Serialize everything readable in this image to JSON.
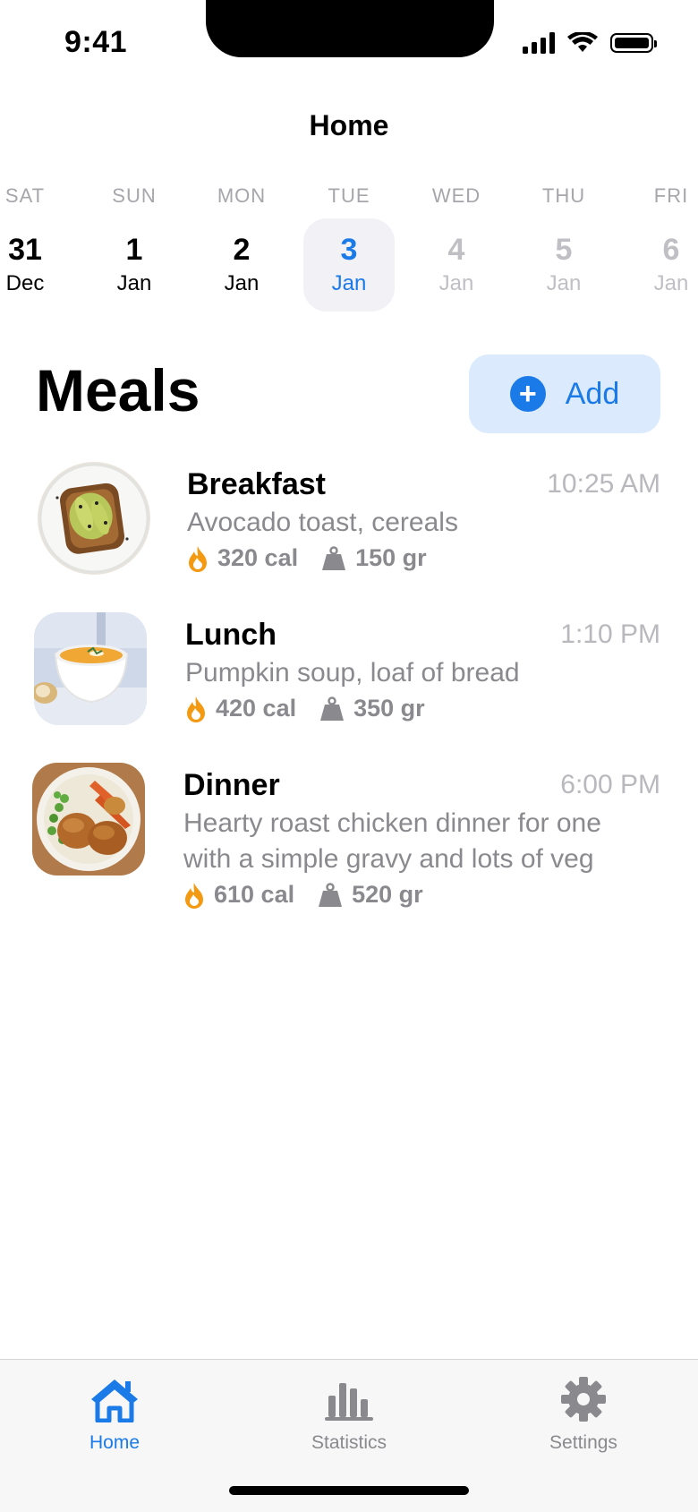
{
  "status_bar": {
    "time": "9:41"
  },
  "nav": {
    "title": "Home"
  },
  "dates": [
    {
      "dow": "SAT",
      "num": "31",
      "mon": "Dec",
      "state": "past"
    },
    {
      "dow": "SUN",
      "num": "1",
      "mon": "Jan",
      "state": "past"
    },
    {
      "dow": "MON",
      "num": "2",
      "mon": "Jan",
      "state": "past"
    },
    {
      "dow": "TUE",
      "num": "3",
      "mon": "Jan",
      "state": "selected"
    },
    {
      "dow": "WED",
      "num": "4",
      "mon": "Jan",
      "state": "future"
    },
    {
      "dow": "THU",
      "num": "5",
      "mon": "Jan",
      "state": "future"
    },
    {
      "dow": "FRI",
      "num": "6",
      "mon": "Jan",
      "state": "future"
    }
  ],
  "meals_section": {
    "title": "Meals",
    "add_label": "Add"
  },
  "meals": [
    {
      "name": "Breakfast",
      "time": "10:25 AM",
      "description": [
        "Avocado toast, cereals"
      ],
      "calories": "320 cal",
      "weight": "150 gr"
    },
    {
      "name": "Lunch",
      "time": "1:10 PM",
      "description": [
        "Pumpkin soup, loaf of bread"
      ],
      "calories": "420 cal",
      "weight": "350 gr"
    },
    {
      "name": "Dinner",
      "time": "6:00 PM",
      "description": [
        "Hearty roast chicken dinner for one",
        "with a simple gravy and lots of veg"
      ],
      "calories": "610 cal",
      "weight": "520 gr"
    }
  ],
  "tabs": [
    {
      "label": "Home",
      "icon": "house-icon",
      "active": true
    },
    {
      "label": "Statistics",
      "icon": "bar-chart-icon",
      "active": false
    },
    {
      "label": "Settings",
      "icon": "gear-icon",
      "active": false
    }
  ],
  "colors": {
    "accent": "#1a7ae8",
    "flame": "#f39a12",
    "muted": "#8a8a8e"
  }
}
